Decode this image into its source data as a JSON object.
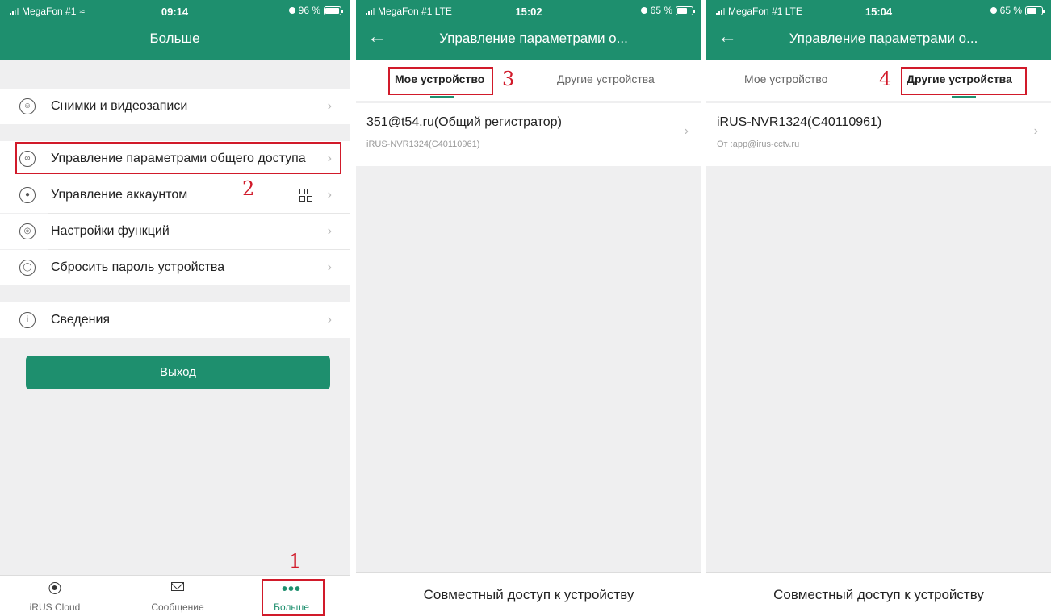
{
  "panel1": {
    "status": {
      "carrier": "MegaFon #1",
      "time": "09:14",
      "battery": "96 %",
      "battery_level": 0.96
    },
    "title": "Больше",
    "menu": [
      {
        "label": "Снимки и видеозаписи",
        "icon": "photo-video-icon"
      },
      {
        "label": "Управление параметрами общего доступа",
        "icon": "share-settings-icon"
      },
      {
        "label": "Управление аккаунтом",
        "icon": "account-icon"
      },
      {
        "label": "Настройки функций",
        "icon": "function-settings-icon"
      },
      {
        "label": "Сбросить пароль устройства",
        "icon": "reset-password-icon"
      },
      {
        "label": "Сведения",
        "icon": "info-icon"
      }
    ],
    "exit_label": "Выход",
    "tabbar": [
      {
        "label": "iRUS Cloud",
        "icon": "cloud-icon"
      },
      {
        "label": "Сообщение",
        "icon": "mail-icon"
      },
      {
        "label": "Больше",
        "icon": "more-dots-icon"
      }
    ],
    "annotations": {
      "n1": "1",
      "n2": "2"
    }
  },
  "panel2": {
    "status": {
      "carrier": "MegaFon #1  LTE",
      "time": "15:02",
      "battery": "65 %",
      "battery_level": 0.65
    },
    "title": "Управление параметрами о...",
    "tabs": {
      "my": "Мое устройство",
      "other": "Другие устройства"
    },
    "device": {
      "title": "351@t54.ru(Общий регистратор)",
      "subtitle": "iRUS-NVR1324(C40110961)"
    },
    "footer": "Совместный доступ к устройству",
    "annotation": "3"
  },
  "panel3": {
    "status": {
      "carrier": "MegaFon #1  LTE",
      "time": "15:04",
      "battery": "65 %",
      "battery_level": 0.65
    },
    "title": "Управление параметрами о...",
    "tabs": {
      "my": "Мое устройство",
      "other": "Другие устройства"
    },
    "device": {
      "title": "iRUS-NVR1324(C40110961)",
      "subtitle": "От :app@irus-cctv.ru"
    },
    "footer": "Совместный доступ к устройству",
    "annotation": "4"
  },
  "colors": {
    "accent": "#1e8f6e",
    "annotation_red": "#d11a2a"
  }
}
